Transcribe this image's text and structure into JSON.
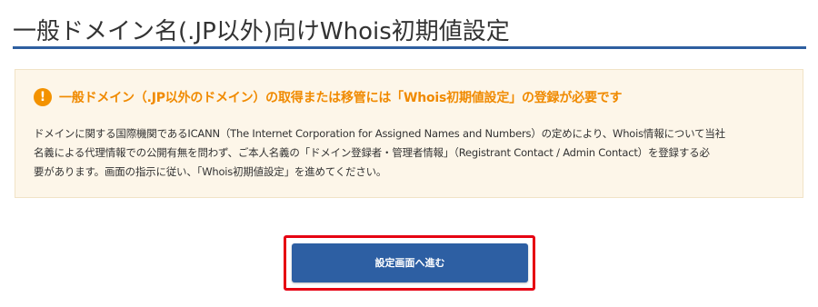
{
  "page": {
    "title": "一般ドメイン名(.JP以外)向けWhois初期値設定"
  },
  "notice": {
    "icon": "exclamation-icon",
    "icon_glyph": "!",
    "title": "一般ドメイン（.JP以外のドメイン）の取得または移管には「Whois初期値設定」の登録が必要です",
    "body_lines": [
      "ドメインに関する国際機関であるICANN（The Internet Corporation for Assigned Names and Numbers）の定めにより、Whois情報について当社",
      "名義による代理情報での公開有無を問わず、ご本人名義の「ドメイン登録者・管理者情報」（Registrant Contact / Admin Contact）を登録する必",
      "要があります。画面の指示に従い、「Whois初期値設定」を進めてください。"
    ]
  },
  "actions": {
    "proceed_label": "設定画面へ進む"
  },
  "colors": {
    "accent_blue": "#2d5fa3",
    "warning_orange": "#f08a00",
    "highlight_red": "#e60012",
    "notice_bg": "#fdf6e9"
  }
}
